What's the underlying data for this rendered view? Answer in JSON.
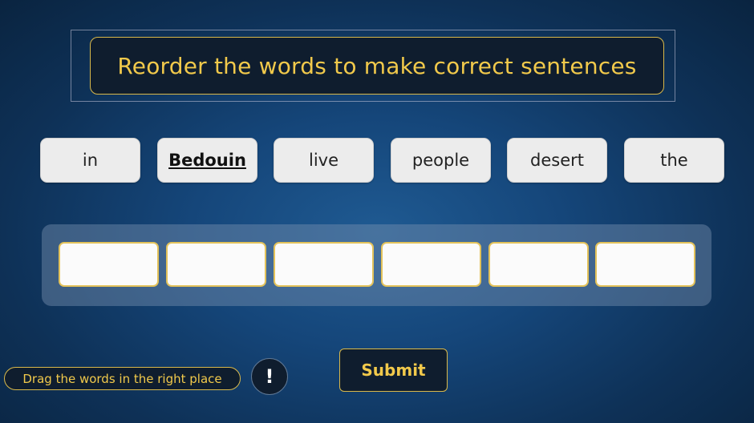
{
  "header": {
    "title": "Reorder the words to make correct sentences"
  },
  "words": [
    {
      "text": "in"
    },
    {
      "text": "Bedouin"
    },
    {
      "text": "live"
    },
    {
      "text": "people"
    },
    {
      "text": "desert"
    },
    {
      "text": "the"
    }
  ],
  "drop_slots": [
    "",
    "",
    "",
    "",
    "",
    ""
  ],
  "footer": {
    "hint_text": "Drag the words in the right place",
    "hint_button_label": "!",
    "submit_label": "Submit"
  },
  "colors": {
    "accent": "#f1c94b",
    "panel": "#0f1d2e",
    "word_tile": "#ececec",
    "slot_border": "#e3c25a"
  }
}
